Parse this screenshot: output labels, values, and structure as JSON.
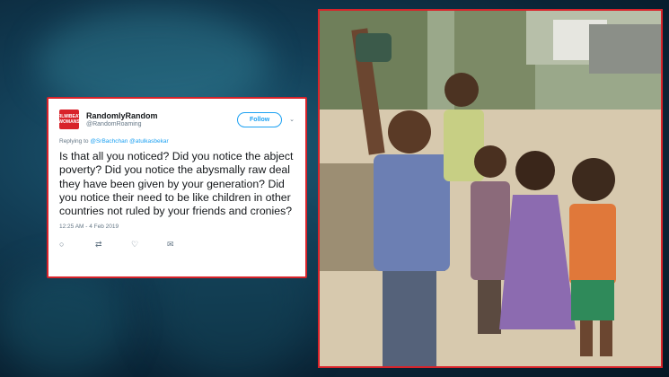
{
  "tweet": {
    "logo_text": "FILMIBEAT WOMANS",
    "display_name": "RandomlyRandom",
    "handle": "@RandomRoaming",
    "follow_label": "Follow",
    "caret": "⌄",
    "replying_prefix": "Replying to",
    "mention_1": "@SrBachchan",
    "mention_2": "@atulkasbekar",
    "text": "Is that all you noticed? Did you notice the abject poverty? Did you notice the abysmally raw deal they have been given by your generation? Did you notice their need to be like children in other countries not ruled by your friends and cronies?",
    "timestamp": "12:25 AM - 4 Feb 2019",
    "actions": {
      "reply_icon": "○",
      "retweet_icon": "⇄",
      "like_icon": "♡",
      "message_icon": "✉"
    }
  },
  "colors": {
    "frame_red": "#d8232a",
    "twitter_blue": "#1da1f2",
    "background": "#0a2436"
  }
}
